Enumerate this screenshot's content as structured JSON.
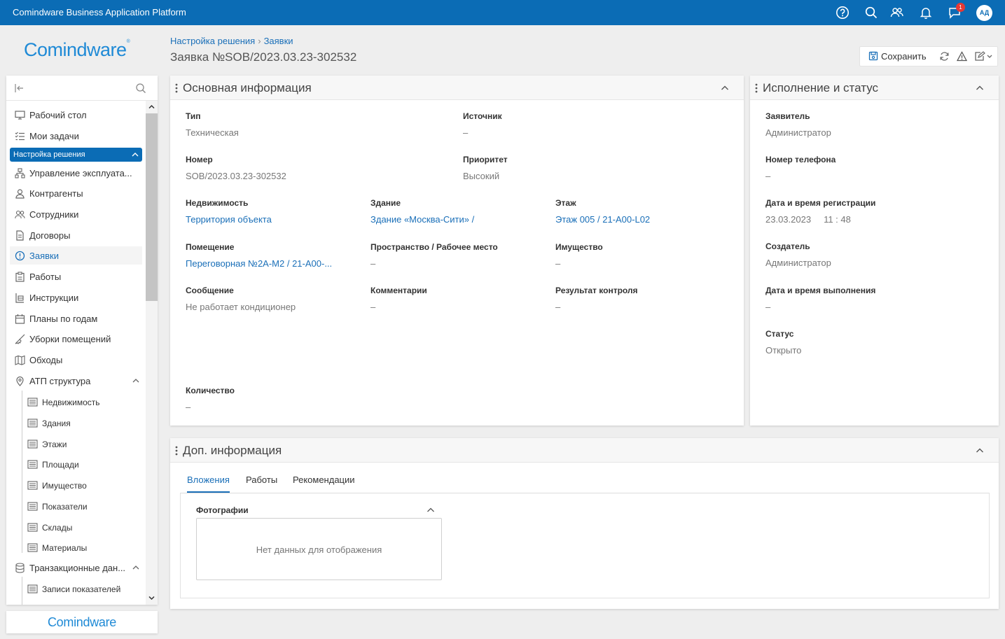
{
  "app": {
    "title": "Comindware Business Application Platform",
    "notification_count": "1",
    "user_initials": "АД"
  },
  "logo": {
    "text": "Comindware",
    "footer_text": "Comindware"
  },
  "breadcrumb": {
    "items": [
      "Настройка решения",
      "Заявки"
    ]
  },
  "page": {
    "title": "Заявка №SOB/2023.03.23-302532"
  },
  "toolbar": {
    "save_label": "Сохранить"
  },
  "sidebar": {
    "items": [
      {
        "label": "Рабочий стол",
        "icon": "desktop-icon"
      },
      {
        "label": "Мои задачи",
        "icon": "tasks-icon"
      },
      {
        "label": "Управление эксплуата...",
        "icon": "sitemap-icon"
      },
      {
        "label": "Контрагенты",
        "icon": "user-icon"
      },
      {
        "label": "Сотрудники",
        "icon": "users-icon"
      },
      {
        "label": "Договоры",
        "icon": "document-icon"
      },
      {
        "label": "Заявки",
        "icon": "alert-circle-icon"
      },
      {
        "label": "Работы",
        "icon": "clipboard-icon"
      },
      {
        "label": "Инструкции",
        "icon": "instructions-icon"
      },
      {
        "label": "Планы по годам",
        "icon": "calendar-icon"
      },
      {
        "label": "Уборки помещений",
        "icon": "broom-icon"
      },
      {
        "label": "Обходы",
        "icon": "map-icon"
      },
      {
        "label": "АТП структура",
        "icon": "pin-icon"
      },
      {
        "label": "Транзакционные дан...",
        "icon": "database-icon"
      }
    ],
    "group_label": "Настройка решения",
    "sub_items": [
      "Недвижимость",
      "Здания",
      "Этажи",
      "Площади",
      "Имущество",
      "Показатели",
      "Склады",
      "Материалы"
    ],
    "sub_items2": [
      "Записи показателей"
    ]
  },
  "main_panel": {
    "title": "Основная информация",
    "fields": {
      "type": {
        "label": "Тип",
        "value": "Техническая"
      },
      "source": {
        "label": "Источник",
        "value": "–"
      },
      "number": {
        "label": "Номер",
        "value": "SOB/2023.03.23-302532"
      },
      "priority": {
        "label": "Приоритет",
        "value": "Высокий"
      },
      "realty": {
        "label": "Недвижимость",
        "value": "Территория объекта"
      },
      "building": {
        "label": "Здание",
        "value": "Здание «Москва-Сити» /"
      },
      "floor": {
        "label": "Этаж",
        "value": "Этаж 005 / 21-A00-L02"
      },
      "room": {
        "label": "Помещение",
        "value": "Переговорная №2А-М2 / 21-A00-..."
      },
      "space": {
        "label": "Пространство / Рабочее место",
        "value": "–"
      },
      "property": {
        "label": "Имущество",
        "value": "–"
      },
      "message": {
        "label": "Сообщение",
        "value": "Не работает кондиционер"
      },
      "comments": {
        "label": "Комментарии",
        "value": "–"
      },
      "control": {
        "label": "Результат контроля",
        "value": "–"
      },
      "quantity": {
        "label": "Количество",
        "value": "–"
      }
    }
  },
  "status_panel": {
    "title": "Исполнение и статус",
    "fields": {
      "applicant": {
        "label": "Заявитель",
        "value": "Администратор"
      },
      "phone": {
        "label": "Номер телефона",
        "value": "–"
      },
      "reg_datetime": {
        "label": "Дата и время регистрации",
        "date": "23.03.2023",
        "time": "11 : 48"
      },
      "creator": {
        "label": "Создатель",
        "value": "Администратор"
      },
      "done_datetime": {
        "label": "Дата и время выполнения",
        "value": "–"
      },
      "status": {
        "label": "Статус",
        "value": "Открыто"
      }
    }
  },
  "extra_panel": {
    "title": "Доп. информация",
    "tabs": [
      "Вложения",
      "Работы",
      "Рекомендации"
    ],
    "photos_label": "Фотографии",
    "empty_text": "Нет данных для отображения"
  },
  "colors": {
    "brand": "#0b6cb5",
    "link": "#1a6fb8",
    "badge": "#e53935"
  }
}
